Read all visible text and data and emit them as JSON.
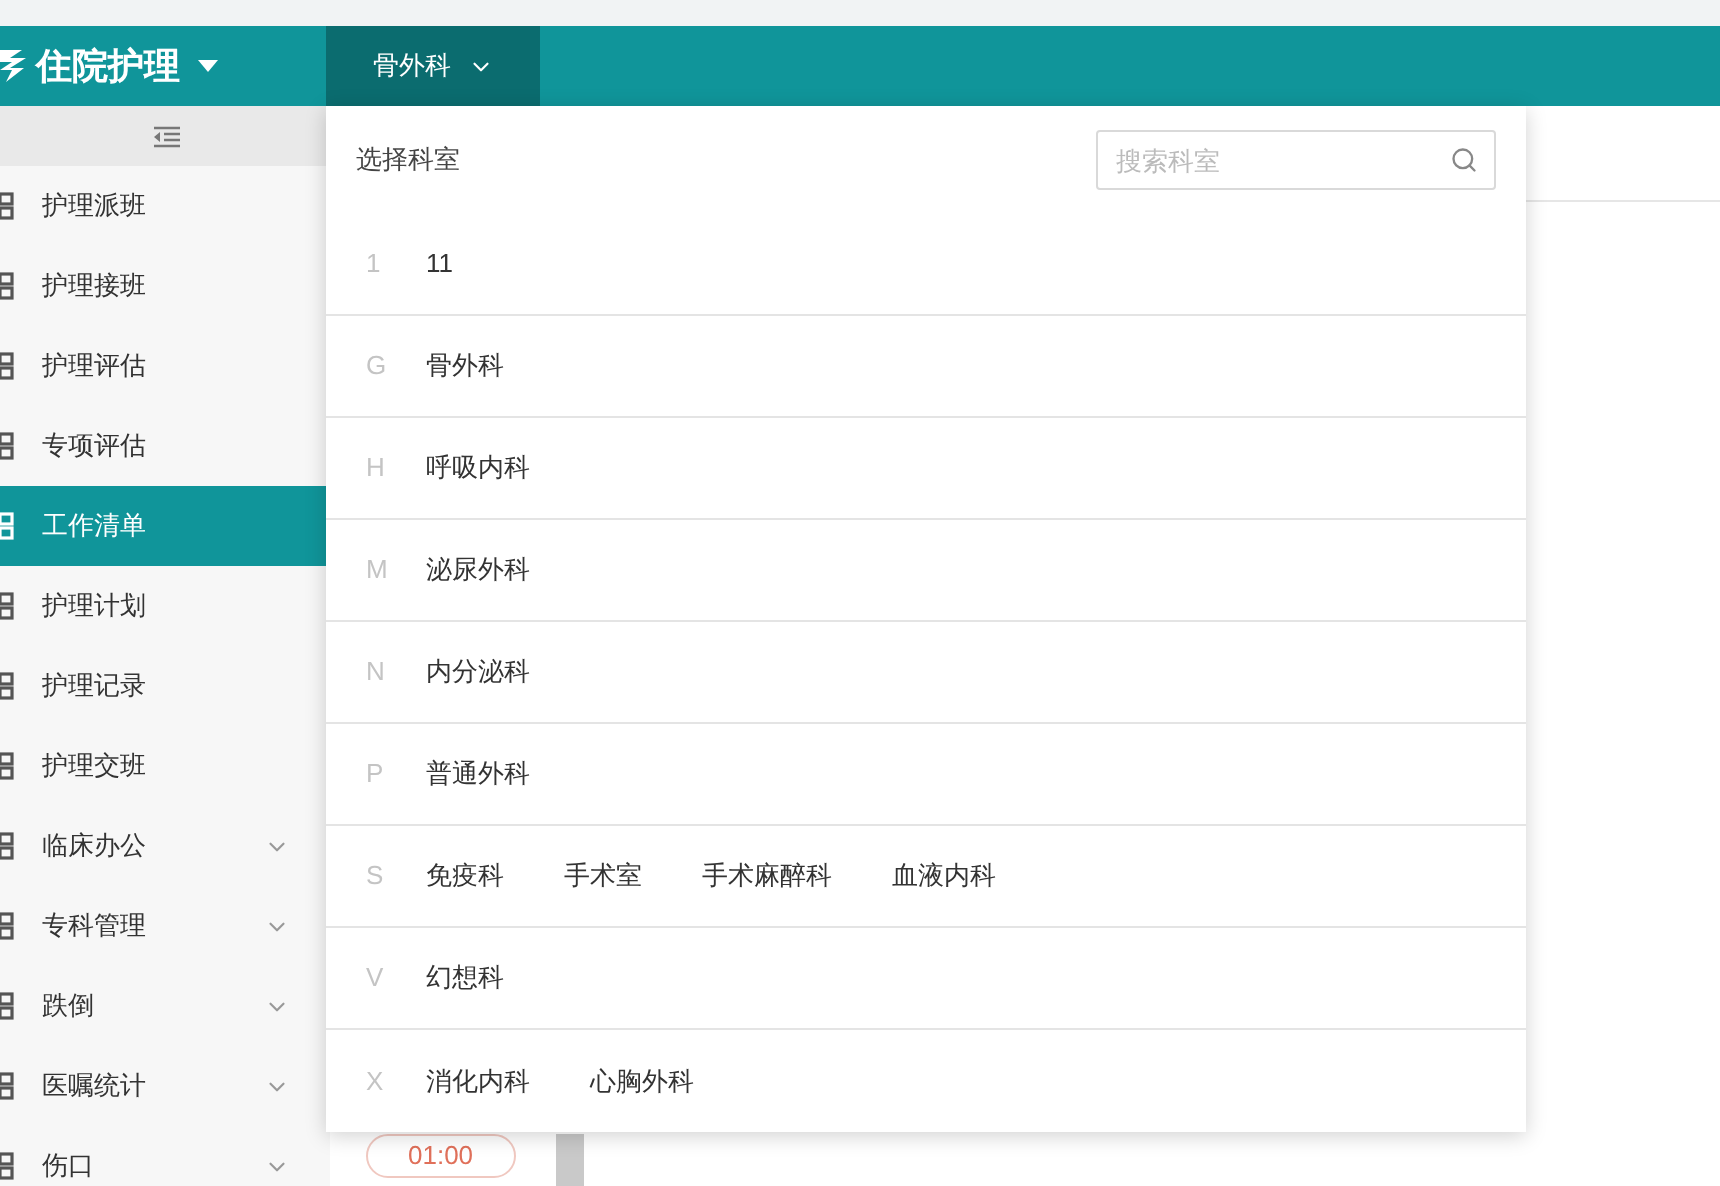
{
  "header": {
    "app_title": "住院护理",
    "department_button": "骨外科"
  },
  "sidebar": {
    "items": [
      {
        "label": "护理派班",
        "selected": false,
        "expandable": false
      },
      {
        "label": "护理接班",
        "selected": false,
        "expandable": false
      },
      {
        "label": "护理评估",
        "selected": false,
        "expandable": false
      },
      {
        "label": "专项评估",
        "selected": false,
        "expandable": false
      },
      {
        "label": "工作清单",
        "selected": true,
        "expandable": false
      },
      {
        "label": "护理计划",
        "selected": false,
        "expandable": false
      },
      {
        "label": "护理记录",
        "selected": false,
        "expandable": false
      },
      {
        "label": "护理交班",
        "selected": false,
        "expandable": false
      },
      {
        "label": "临床办公",
        "selected": false,
        "expandable": true
      },
      {
        "label": "专科管理",
        "selected": false,
        "expandable": true
      },
      {
        "label": "跌倒",
        "selected": false,
        "expandable": true
      },
      {
        "label": "医嘱统计",
        "selected": false,
        "expandable": true
      },
      {
        "label": "伤口",
        "selected": false,
        "expandable": true
      }
    ]
  },
  "background": {
    "time_pill": "01:00"
  },
  "department_picker": {
    "title": "选择科室",
    "search": {
      "placeholder": "搜索科室"
    },
    "groups": [
      {
        "letter": "1",
        "departments": [
          "11"
        ]
      },
      {
        "letter": "G",
        "departments": [
          "骨外科"
        ]
      },
      {
        "letter": "H",
        "departments": [
          "呼吸内科"
        ]
      },
      {
        "letter": "M",
        "departments": [
          "泌尿外科"
        ]
      },
      {
        "letter": "N",
        "departments": [
          "内分泌科"
        ]
      },
      {
        "letter": "P",
        "departments": [
          "普通外科"
        ]
      },
      {
        "letter": "S",
        "departments": [
          "免疫科",
          "手术室",
          "手术麻醉科",
          "血液内科"
        ]
      },
      {
        "letter": "V",
        "departments": [
          "幻想科"
        ]
      },
      {
        "letter": "X",
        "departments": [
          "消化内科",
          "心胸外科"
        ]
      }
    ]
  }
}
